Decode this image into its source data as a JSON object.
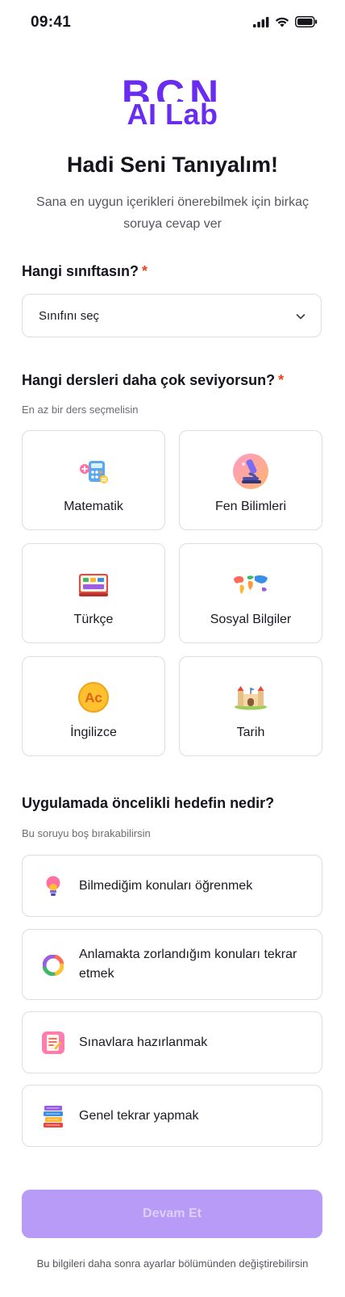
{
  "status_bar": {
    "time": "09:41"
  },
  "logo": {
    "line1": "BCN",
    "line2": "AI Lab"
  },
  "header": {
    "title": "Hadi Seni Tanıyalım!",
    "subtitle": "Sana en uygun içerikleri önerebilmek için birkaç soruya cevap ver"
  },
  "grade": {
    "label": "Hangi sınıftasın?",
    "required_mark": "*",
    "select_value": "Sınıfını seç"
  },
  "subjects": {
    "label": "Hangi dersleri daha çok seviyorsun?",
    "required_mark": "*",
    "hint": "En az bir ders seçmelisin",
    "items": [
      {
        "label": "Matematik",
        "icon": "calculator-icon"
      },
      {
        "label": "Fen Bilimleri",
        "icon": "microscope-icon"
      },
      {
        "label": "Türkçe",
        "icon": "book-icon"
      },
      {
        "label": "Sosyal Bilgiler",
        "icon": "world-map-icon"
      },
      {
        "label": "İngilizce",
        "icon": "language-icon"
      },
      {
        "label": "Tarih",
        "icon": "castle-icon"
      }
    ]
  },
  "goals": {
    "label": "Uygulamada öncelikli hedefin nedir?",
    "hint": "Bu soruyu boş bırakabilirsin",
    "items": [
      {
        "text": "Bilmediğim konuları öğrenmek",
        "icon": "lightbulb-icon"
      },
      {
        "text": "Anlamakta zorlandığım konuları tekrar etmek",
        "icon": "refresh-ring-icon"
      },
      {
        "text": "Sınavlara hazırlanmak",
        "icon": "exam-paper-icon"
      },
      {
        "text": "Genel tekrar yapmak",
        "icon": "book-stack-icon"
      }
    ]
  },
  "continue_label": "Devam Et",
  "footer_note": "Bu bilgileri daha sonra ayarlar bölümünden değiştirebilirsin",
  "colors": {
    "brand": "#6a2cf0",
    "button_disabled": "#b79bf7",
    "required": "#e8451f",
    "border": "#dcdce2"
  }
}
